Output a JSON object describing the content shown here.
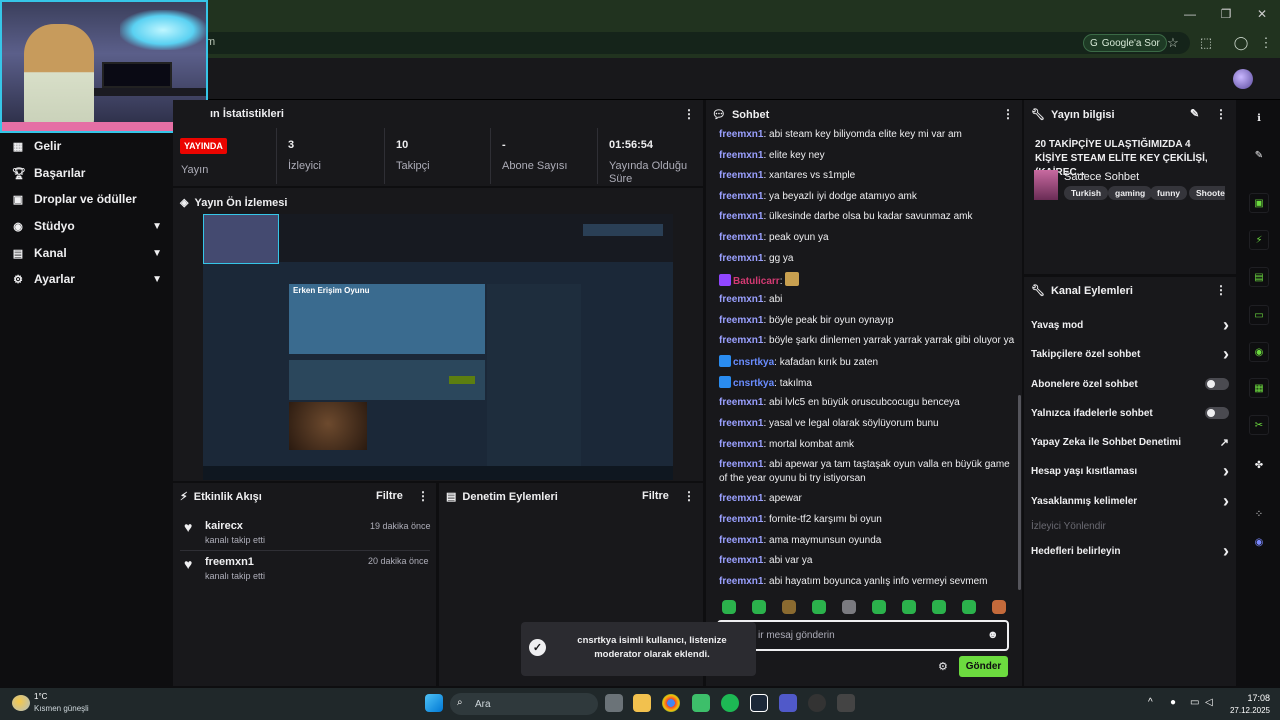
{
  "browser": {
    "url_text": "m",
    "google_sor": "Google'a Sor"
  },
  "sidebar": {
    "items": [
      {
        "label": "Gelir",
        "icon": "revenue-icon",
        "chevron": false
      },
      {
        "label": "Başarılar",
        "icon": "trophy-icon",
        "chevron": false
      },
      {
        "label": "Droplar ve ödüller",
        "icon": "gift-icon",
        "chevron": false
      },
      {
        "label": "Stüdyo",
        "icon": "studio-icon",
        "chevron": true
      },
      {
        "label": "Kanal",
        "icon": "channel-icon",
        "chevron": true
      },
      {
        "label": "Ayarlar",
        "icon": "gear-icon",
        "chevron": true
      }
    ]
  },
  "stats": {
    "title": "ın İstatistikleri",
    "live_badge": "YAYINDA",
    "items": [
      {
        "value": "",
        "label": "Yayın"
      },
      {
        "value": "3",
        "label": "İzleyici"
      },
      {
        "value": "10",
        "label": "Takipçi"
      },
      {
        "value": "-",
        "label": "Abone Sayısı"
      },
      {
        "value": "01:56:54",
        "label": "Yayında Olduğu Süre"
      }
    ]
  },
  "preview": {
    "title": "Yayın Ön İzlemesi",
    "inner_title": "Erken Erişim Oyunu"
  },
  "activity": {
    "title": "Etkinlik Akışı",
    "filter": "Filtre",
    "events": [
      {
        "name": "kairecx",
        "sub": "kanalı takip etti",
        "time": "19 dakika önce"
      },
      {
        "name": "freemxn1",
        "sub": "kanalı takip etti",
        "time": "20 dakika önce"
      }
    ]
  },
  "moderation": {
    "title": "Denetim Eylemleri",
    "filter": "Filtre"
  },
  "chat": {
    "title": "Sohbet",
    "messages": [
      {
        "user": "freemxn1",
        "text": "abi steam key biliyomda elite key mi var am",
        "style": ""
      },
      {
        "user": "freemxn1",
        "text": "elite key ney",
        "style": ""
      },
      {
        "user": "freemxn1",
        "text": "xantares vs s1mple",
        "style": ""
      },
      {
        "user": "freemxn1",
        "text": "ya beyazlı iyi dodge atamıyo amk",
        "style": ""
      },
      {
        "user": "freemxn1",
        "text": "ülkesinde darbe olsa bu kadar savunmaz amk",
        "style": ""
      },
      {
        "user": "freemxn1",
        "text": "peak oyun ya",
        "style": ""
      },
      {
        "user": "freemxn1",
        "text": "gg ya",
        "style": ""
      },
      {
        "user": "Batulicarr",
        "text": "",
        "style": "pink"
      },
      {
        "user": "freemxn1",
        "text": "abi",
        "style": ""
      },
      {
        "user": "freemxn1",
        "text": "böyle peak bir oyun oynayıp",
        "style": ""
      },
      {
        "user": "freemxn1",
        "text": "böyle şarkı dinlemen yarrak yarrak yarrak gibi oluyor ya",
        "style": ""
      },
      {
        "user": "cnsrtkya",
        "text": "kafadan kırık bu zaten",
        "style": "blue"
      },
      {
        "user": "cnsrtkya",
        "text": "takılma",
        "style": "blue"
      },
      {
        "user": "freemxn1",
        "text": "abi lvlc5 en büyük oruscubcocugu benceya",
        "style": ""
      },
      {
        "user": "freemxn1",
        "text": "yasal ve legal olarak söylüyorum bunu",
        "style": ""
      },
      {
        "user": "freemxn1",
        "text": "mortal kombat amk",
        "style": ""
      },
      {
        "user": "freemxn1",
        "text": "abi apewar ya tam taştaşak oyun valla en büyük game of the year oyunu bi try istiyorsan",
        "style": ""
      },
      {
        "user": "freemxn1",
        "text": "apewar",
        "style": ""
      },
      {
        "user": "freemxn1",
        "text": "fornite-tf2 karşımı bi oyun",
        "style": ""
      },
      {
        "user": "freemxn1",
        "text": "ama maymunsun oyunda",
        "style": ""
      },
      {
        "user": "freemxn1",
        "text": "abi var ya",
        "style": ""
      },
      {
        "user": "freemxn1",
        "text": "abi hayatım boyunca yanlış info vermeyi sevmem",
        "style": ""
      }
    ],
    "placeholder": "ir mesaj gönderin",
    "send": "Gönder"
  },
  "toast": {
    "text": "cnsrtkya isimli kullanıcı, listenize moderator olarak eklendi."
  },
  "stream_info": {
    "title": "Yayın bilgisi",
    "stream_title": "20 TAKİPÇİYE ULAŞTIĞIMIZDA 4 KİŞİYE STEAM ELİTE KEY ÇEKİLİŞİ, (KAİREC...",
    "game": "Sadece Sohbet",
    "tags": [
      "Turkish",
      "gaming",
      "funny",
      "Shooter"
    ]
  },
  "channel_actions": {
    "title": "Kanal Eylemleri",
    "rows": [
      {
        "label": "Yavaş mod",
        "control": "chevron"
      },
      {
        "label": "Takipçilere özel sohbet",
        "control": "chevron"
      },
      {
        "label": "Abonelere özel sohbet",
        "control": "toggle"
      },
      {
        "label": "Yalnızca ifadelerle sohbet",
        "control": "toggle"
      },
      {
        "label": "Yapay Zeka ile Sohbet Denetimi",
        "control": "external"
      },
      {
        "label": "Hesap yaşı kısıtlaması",
        "control": "chevron"
      },
      {
        "label": "Yasaklanmış kelimeler",
        "control": "chevron"
      },
      {
        "label": "İzleyici Yönlendir",
        "control": "disabled"
      },
      {
        "label": "Hedefleri belirleyin",
        "control": "chevron"
      }
    ]
  },
  "taskbar": {
    "temp": "1°C",
    "weather": "Kısmen güneşli",
    "search": "Ara",
    "time": "17:08",
    "date": "27.12.2025"
  },
  "colors": {
    "accent": "#6cdb3f",
    "live": "#eb0400",
    "chrome": "#21331f"
  }
}
